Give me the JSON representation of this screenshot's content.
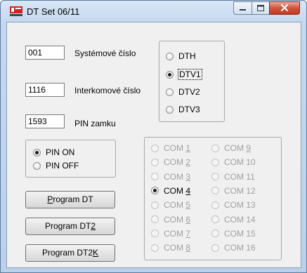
{
  "window": {
    "title": "DT Set  06/11",
    "logo_text": "elektro",
    "controls": {
      "minimize_icon": "minimize-icon",
      "maximize_icon": "maximize-icon",
      "close_icon": "close-icon"
    }
  },
  "fields": [
    {
      "value": "001",
      "label": "Systémové číslo"
    },
    {
      "value": "1116",
      "label": "Interkomové číslo"
    },
    {
      "value": "1593",
      "label": "PIN zamku"
    }
  ],
  "dt_options": {
    "items": [
      {
        "label": "DTH",
        "checked": false
      },
      {
        "label": "DTV1",
        "checked": true
      },
      {
        "label": "DTV2",
        "checked": false
      },
      {
        "label": "DTV3",
        "checked": false
      }
    ]
  },
  "pin_options": {
    "items": [
      {
        "label": "PIN ON",
        "checked": true
      },
      {
        "label": "PIN OFF",
        "checked": false
      }
    ]
  },
  "com_ports": {
    "col1": [
      {
        "pre": "COM ",
        "key": "1",
        "checked": false,
        "enabled": false
      },
      {
        "pre": "COM ",
        "key": "2",
        "checked": false,
        "enabled": false
      },
      {
        "pre": "COM ",
        "key": "3",
        "checked": false,
        "enabled": false
      },
      {
        "pre": "COM ",
        "key": "4",
        "checked": true,
        "enabled": true
      },
      {
        "pre": "COM ",
        "key": "5",
        "checked": false,
        "enabled": false
      },
      {
        "pre": "COM ",
        "key": "6",
        "checked": false,
        "enabled": false
      },
      {
        "pre": "COM ",
        "key": "7",
        "checked": false,
        "enabled": false
      },
      {
        "pre": "COM ",
        "key": "8",
        "checked": false,
        "enabled": false
      }
    ],
    "col2": [
      {
        "pre": "COM ",
        "key": "9",
        "checked": false,
        "enabled": false
      },
      {
        "pre": "COM 10",
        "key": "",
        "checked": false,
        "enabled": false
      },
      {
        "pre": "COM 11",
        "key": "",
        "checked": false,
        "enabled": false
      },
      {
        "pre": "COM 12",
        "key": "",
        "checked": false,
        "enabled": false
      },
      {
        "pre": "COM 13",
        "key": "",
        "checked": false,
        "enabled": false
      },
      {
        "pre": "COM 14",
        "key": "",
        "checked": false,
        "enabled": false
      },
      {
        "pre": "COM 15",
        "key": "",
        "checked": false,
        "enabled": false
      },
      {
        "pre": "COM 16",
        "key": "",
        "checked": false,
        "enabled": false
      }
    ]
  },
  "buttons": [
    {
      "pre": "",
      "key": "P",
      "post": "rogram DT"
    },
    {
      "pre": "Program DT",
      "key": "2",
      "post": ""
    },
    {
      "pre": "Program DT2",
      "key": "K",
      "post": ""
    }
  ]
}
